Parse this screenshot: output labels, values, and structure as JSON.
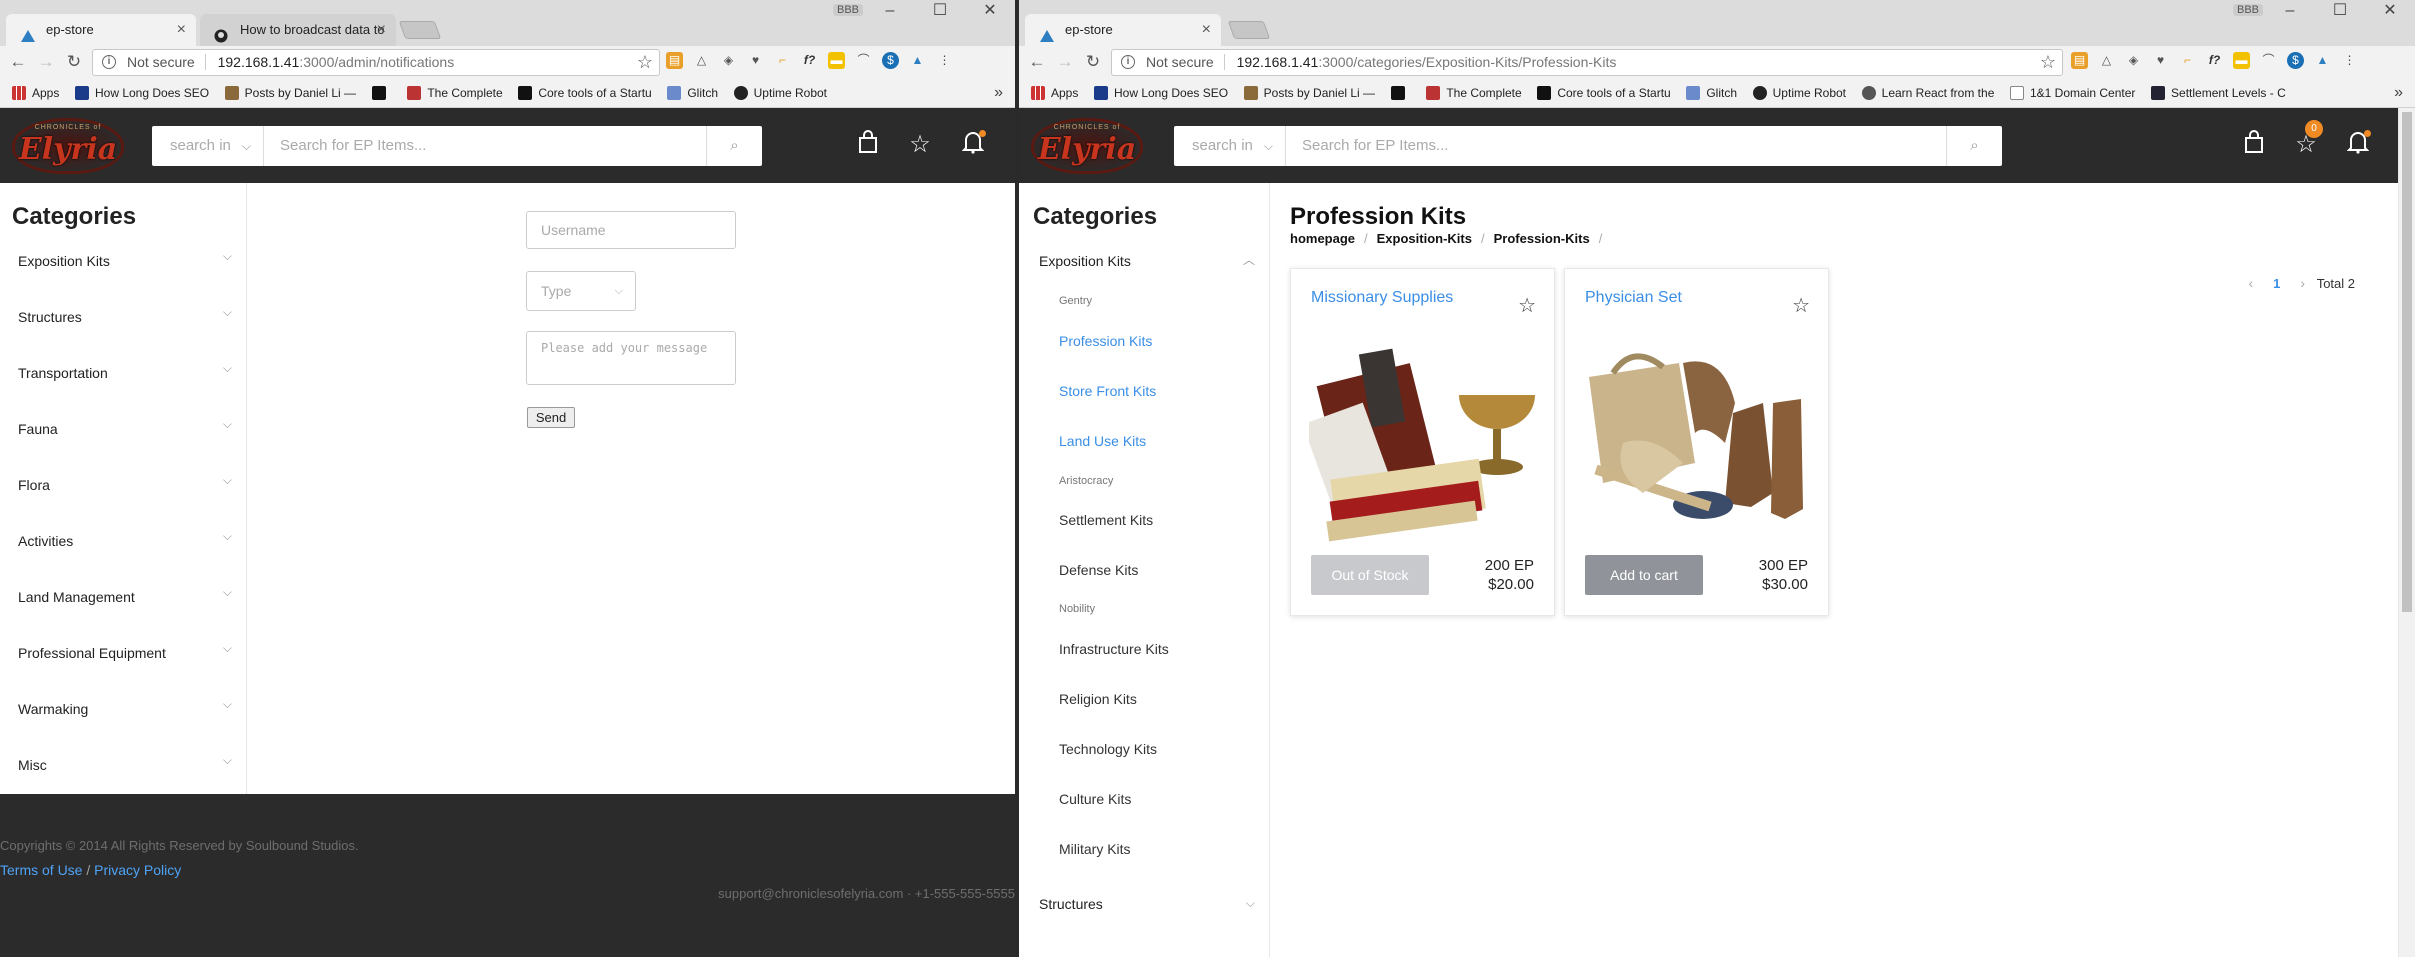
{
  "left": {
    "tabs": [
      {
        "title": "ep-store",
        "active": true
      },
      {
        "title": "How to broadcast data to",
        "active": false
      }
    ],
    "user_badge": "BBB",
    "address": {
      "not_secure": "Not secure",
      "host": "192.168.1.41",
      "path": ":3000/admin/notifications"
    },
    "bookmarks": [
      "Apps",
      "How Long Does SEO",
      "Posts by Daniel Li —",
      "",
      "The Complete",
      "Core tools of a Startu",
      "Glitch",
      "Uptime Robot"
    ],
    "header": {
      "search_category": "search in",
      "search_placeholder": "Search for EP Items..."
    },
    "sidebar": {
      "title": "Categories",
      "items": [
        "Exposition Kits",
        "Structures",
        "Transportation",
        "Fauna",
        "Flora",
        "Activities",
        "Land Management",
        "Professional Equipment",
        "Warmaking",
        "Misc"
      ]
    },
    "form": {
      "username_placeholder": "Username",
      "type_placeholder": "Type",
      "message_placeholder": "Please add your message",
      "send_label": "Send"
    },
    "footer": {
      "copyright": "Copyrights © 2014 All Rights Reserved by Soulbound Studios.",
      "terms": "Terms of Use",
      "sep": "/",
      "privacy": "Privacy Policy",
      "contact": "support@chroniclesofelyria.com · +1-555-555-5555"
    }
  },
  "right": {
    "tabs": [
      {
        "title": "ep-store",
        "active": true
      }
    ],
    "user_badge": "BBB",
    "address": {
      "not_secure": "Not secure",
      "host": "192.168.1.41",
      "path": ":3000/categories/Exposition-Kits/Profession-Kits"
    },
    "bookmarks": [
      "Apps",
      "How Long Does SEO",
      "Posts by Daniel Li —",
      "",
      "The Complete",
      "Core tools of a Startu",
      "Glitch",
      "Uptime Robot",
      "Learn React from the",
      "1&1 Domain Center",
      "Settlement Levels - C"
    ],
    "header": {
      "search_category": "search in",
      "search_placeholder": "Search for EP Items...",
      "cart_count": "0"
    },
    "sidebar": {
      "title": "Categories",
      "open_item": "Exposition Kits",
      "subitems": [
        {
          "label": "Gentry",
          "kind": "group"
        },
        {
          "label": "Profession Kits",
          "kind": "active"
        },
        {
          "label": "Store Front Kits",
          "kind": "active"
        },
        {
          "label": "Land Use Kits",
          "kind": "active"
        },
        {
          "label": "Aristocracy",
          "kind": "group"
        },
        {
          "label": "Settlement Kits",
          "kind": "item"
        },
        {
          "label": "Defense Kits",
          "kind": "item"
        },
        {
          "label": "Nobility",
          "kind": "group"
        },
        {
          "label": "Infrastructure Kits",
          "kind": "item"
        },
        {
          "label": "Religion Kits",
          "kind": "item"
        },
        {
          "label": "Technology Kits",
          "kind": "item"
        },
        {
          "label": "Culture Kits",
          "kind": "item"
        },
        {
          "label": "Military Kits",
          "kind": "item"
        }
      ],
      "next_item": "Structures"
    },
    "main": {
      "title": "Profession Kits",
      "breadcrumb": [
        "homepage",
        "Exposition-Kits",
        "Profession-Kits"
      ],
      "pager": {
        "page": "1",
        "total": "Total 2"
      },
      "products": [
        {
          "name": "Missionary Supplies",
          "button": "Out of Stock",
          "ep": "200 EP",
          "usd": "$20.00",
          "in_stock": false
        },
        {
          "name": "Physician Set",
          "button": "Add to cart",
          "ep": "300 EP",
          "usd": "$30.00",
          "in_stock": true
        }
      ]
    }
  },
  "colors": {
    "header_bg": "#2b2b2b",
    "link_blue": "#3a8ee6",
    "notify_orange": "#f08a24",
    "brand_red": "#c8351f"
  }
}
